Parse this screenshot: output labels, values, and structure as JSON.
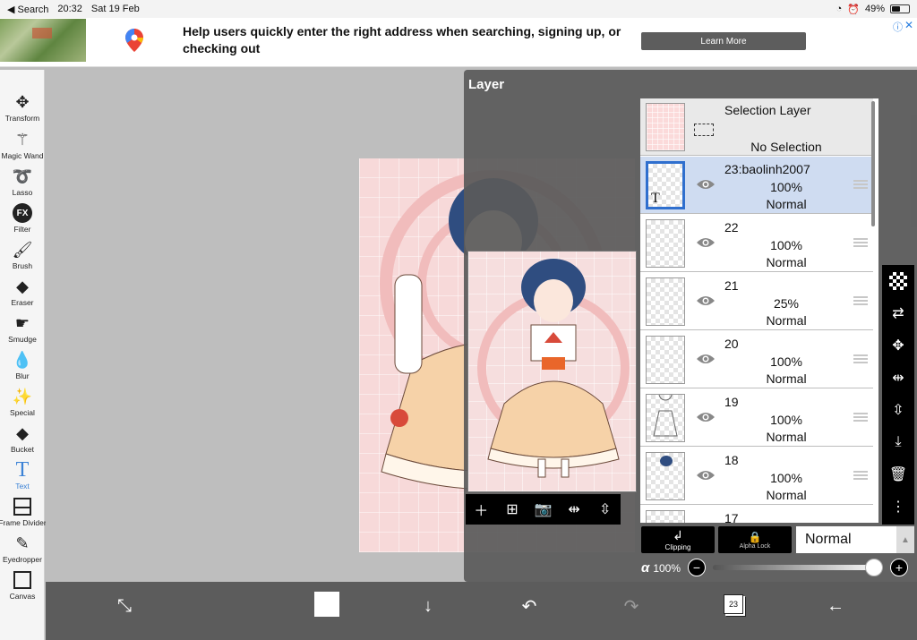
{
  "status_bar": {
    "back_label": "◀ Search",
    "time": "20:32",
    "date": "Sat 19 Feb",
    "battery": "49%",
    "battery_level": 0.49
  },
  "ad": {
    "headline": "Help users quickly enter the right address when searching, signing up, or checking out",
    "cta": "Learn More"
  },
  "tools": [
    {
      "label": "Transform",
      "icon": "move-arrows-icon"
    },
    {
      "label": "Magic Wand",
      "icon": "magic-wand-icon"
    },
    {
      "label": "Lasso",
      "icon": "lasso-icon"
    },
    {
      "label": "Filter",
      "icon": "fx-icon"
    },
    {
      "label": "Brush",
      "icon": "brush-icon"
    },
    {
      "label": "Eraser",
      "icon": "eraser-icon"
    },
    {
      "label": "Smudge",
      "icon": "smudge-icon"
    },
    {
      "label": "Blur",
      "icon": "drop-icon"
    },
    {
      "label": "Special",
      "icon": "sparkle-icon"
    },
    {
      "label": "Bucket",
      "icon": "bucket-icon"
    },
    {
      "label": "Text",
      "icon": "text-icon",
      "active": true
    },
    {
      "label": "Frame Divider",
      "icon": "frame-divider-icon"
    },
    {
      "label": "Eyedropper",
      "icon": "eyedropper-icon"
    },
    {
      "label": "Canvas",
      "icon": "canvas-icon"
    }
  ],
  "layer_panel": {
    "title": "Layer",
    "selection_layer": {
      "title": "Selection Layer",
      "status": "No Selection"
    },
    "layers": [
      {
        "name": "23:baolinh2007",
        "opacity": "100%",
        "blend": "Normal",
        "selected": true,
        "text_layer": true
      },
      {
        "name": "22",
        "opacity": "100%",
        "blend": "Normal"
      },
      {
        "name": "21",
        "opacity": "25%",
        "blend": "Normal"
      },
      {
        "name": "20",
        "opacity": "100%",
        "blend": "Normal"
      },
      {
        "name": "19",
        "opacity": "100%",
        "blend": "Normal"
      },
      {
        "name": "18",
        "opacity": "100%",
        "blend": "Normal"
      },
      {
        "name": "17"
      }
    ],
    "clipping_label": "Clipping",
    "alpha_lock_label": "Alpha Lock",
    "blend_mode": "Normal",
    "alpha_symbol": "α",
    "alpha_value": "100%",
    "alpha_fraction": 1.0
  },
  "bottom": {
    "layer_count": "23"
  },
  "colors": {
    "accent": "#3b82d6",
    "selected_row": "#cfdcf1",
    "panel": "#5a5a5a",
    "artboard_pink": "#f7d9d9"
  }
}
